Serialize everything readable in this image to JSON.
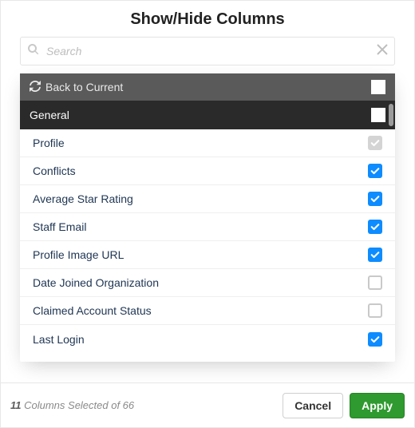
{
  "modal": {
    "title": "Show/Hide Columns",
    "search": {
      "placeholder": "Search"
    },
    "back_to_current": "Back to Current",
    "section_label": "General",
    "columns": [
      {
        "label": "Profile",
        "state": "disabled"
      },
      {
        "label": "Conflicts",
        "state": "checked"
      },
      {
        "label": "Average Star Rating",
        "state": "checked"
      },
      {
        "label": "Staff Email",
        "state": "checked"
      },
      {
        "label": "Profile Image URL",
        "state": "checked"
      },
      {
        "label": "Date Joined Organization",
        "state": "unchecked"
      },
      {
        "label": "Claimed Account Status",
        "state": "unchecked"
      },
      {
        "label": "Last Login",
        "state": "checked"
      }
    ],
    "status": {
      "count": "11",
      "rest": " Columns Selected of 66"
    },
    "buttons": {
      "cancel": "Cancel",
      "apply": "Apply"
    },
    "colors": {
      "accent": "#0d8cff",
      "apply": "#2f9a2f"
    }
  }
}
